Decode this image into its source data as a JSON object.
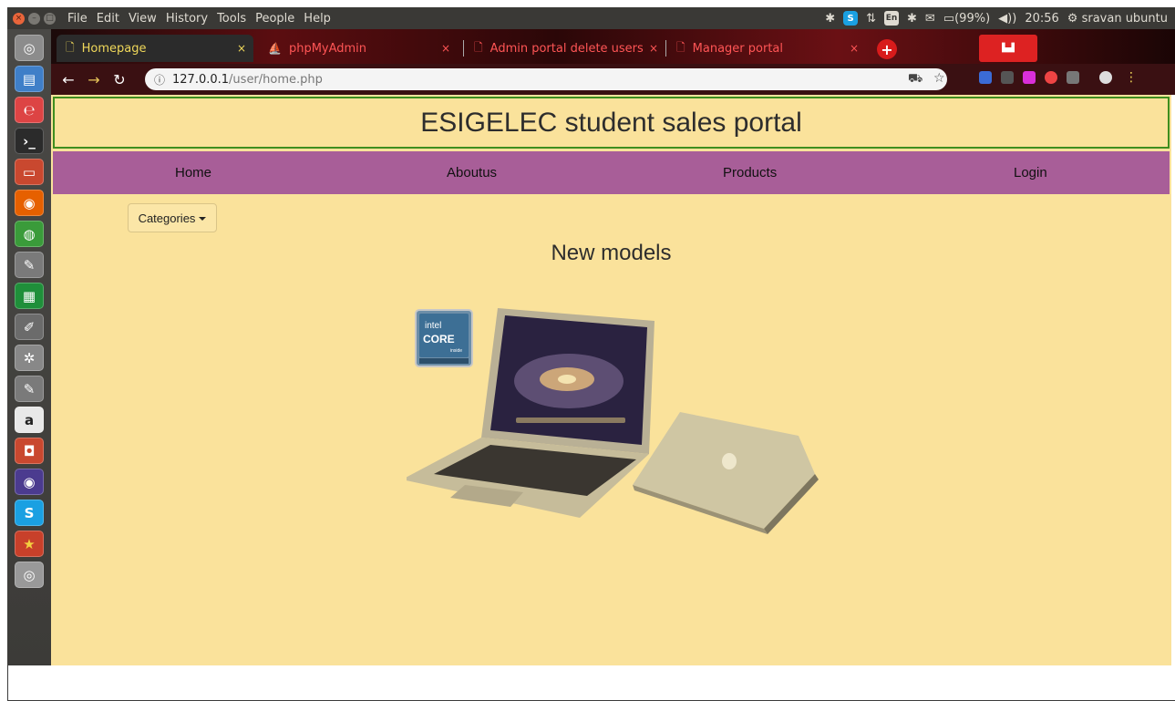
{
  "system_panel": {
    "menus": [
      "File",
      "Edit",
      "View",
      "History",
      "Tools",
      "People",
      "Help"
    ],
    "battery": "(99%)",
    "time": "20:56",
    "user": "sravan ubuntu",
    "keyboard": "En"
  },
  "browser": {
    "tabs": [
      {
        "label": "Homepage",
        "active": true
      },
      {
        "label": "phpMyAdmin",
        "active": false
      },
      {
        "label": "Admin portal delete users",
        "active": false
      },
      {
        "label": "Manager portal",
        "active": false
      }
    ],
    "address": {
      "host": "127.0.0.1",
      "path": "/user/home.php"
    }
  },
  "page": {
    "site_title": "ESIGELEC student sales portal",
    "nav": [
      "Home",
      "Aboutus",
      "Products",
      "Login"
    ],
    "categories_label": "Categories",
    "section_title": "New models",
    "intel_badge": {
      "brand": "intel",
      "line": "CORE",
      "sub": "inside"
    }
  },
  "colors": {
    "page_bg": "#fae29b",
    "nav_bg": "#a85e98",
    "header_border": "#3e8e1f",
    "accent_tab_text": "#f0d85a"
  }
}
